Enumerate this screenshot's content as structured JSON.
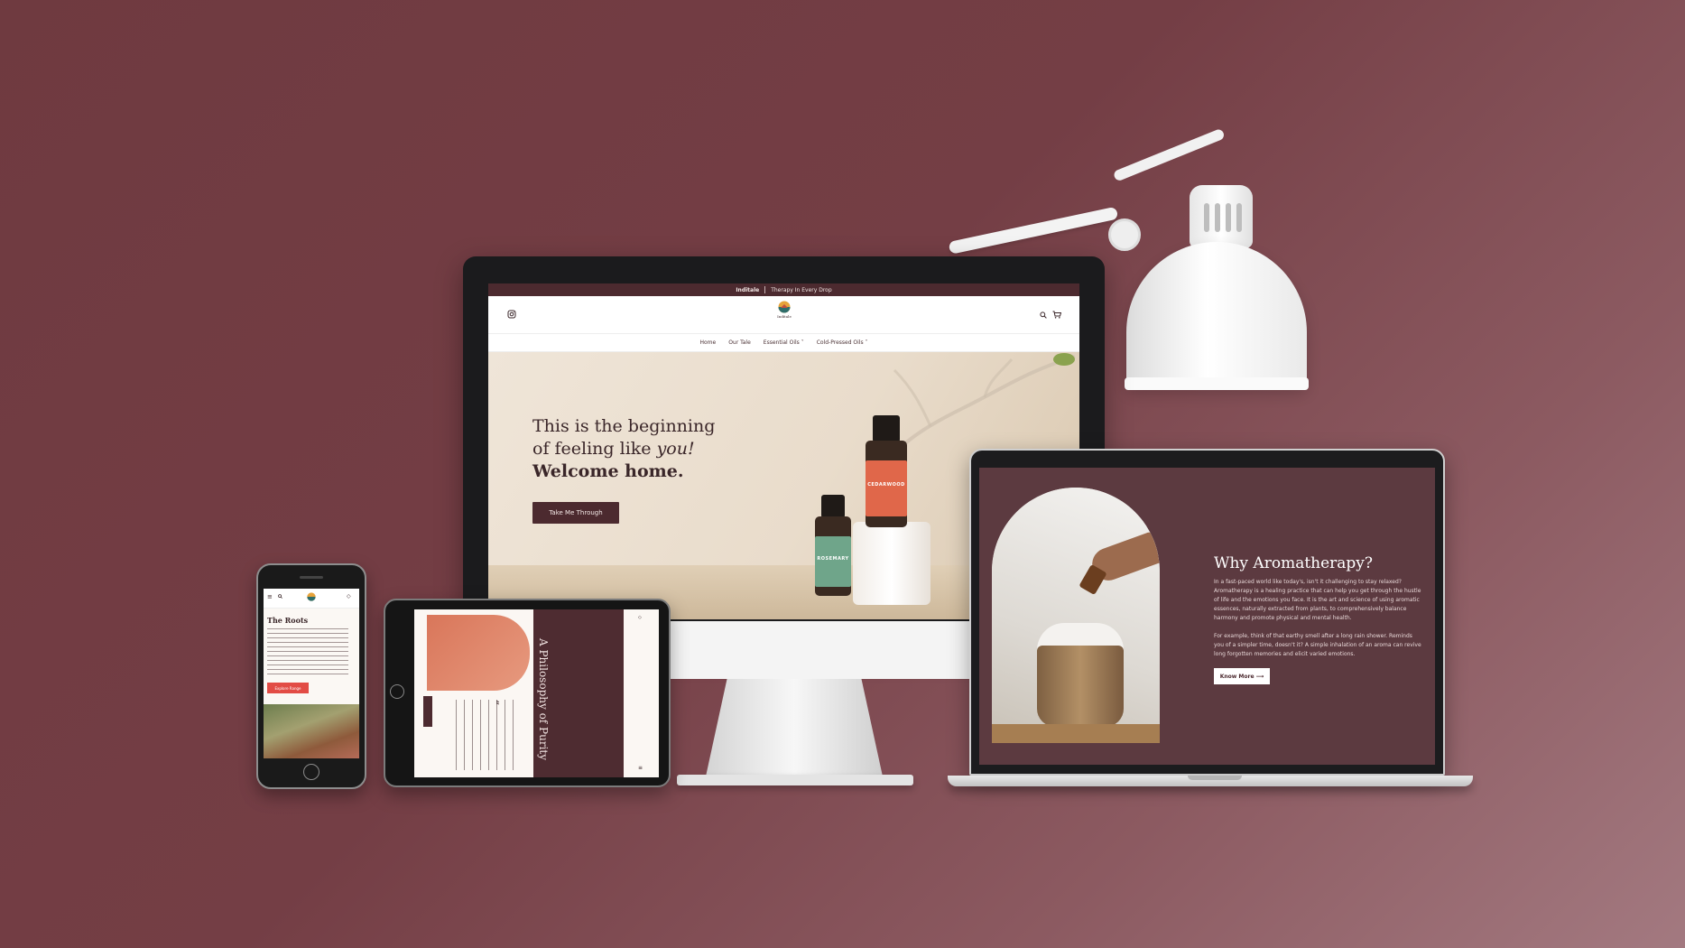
{
  "desktop": {
    "topbar": {
      "brand": "Inditale",
      "tagline": "Therapy In Every Drop"
    },
    "logo_text": "Inditale",
    "nav": [
      {
        "label": "Home"
      },
      {
        "label": "Our Tale"
      },
      {
        "label": "Essential Oils"
      },
      {
        "label": "Cold-Pressed Oils"
      }
    ],
    "hero": {
      "line1": "This is the beginning",
      "line2_prefix": "of feeling like ",
      "line2_em": "you!",
      "line3": "Welcome home.",
      "cta": "Take Me Through"
    },
    "bottles": [
      {
        "name": "ROSEMARY",
        "color": "#6fa58a"
      },
      {
        "name": "CEDARWOOD",
        "color": "#e0674a"
      }
    ]
  },
  "laptop": {
    "title": "Why Aromatherapy?",
    "para1": "In a fast-paced world like today's, isn't it challenging to stay relaxed? Aromatherapy is a healing practice that can help you get through the hustle of life and the emotions you face. It is the art and science of using aromatic essences, naturally extracted from plants, to comprehensively balance harmony and promote physical and mental health.",
    "para2": "For example, think of that earthy smell after a long rain shower. Reminds you of a simpler time, doesn't it? A simple inhalation of an aroma can revive long forgotten memories and elicit varied emotions.",
    "cta": "Know More ⟶"
  },
  "tablet": {
    "title": "A Philosophy of Purity"
  },
  "phone": {
    "title": "The Roots",
    "cta": "Explore Range"
  },
  "colors": {
    "background": "#743e45",
    "brand_dark": "#4c2a2f",
    "accent_red": "#e24c45"
  }
}
